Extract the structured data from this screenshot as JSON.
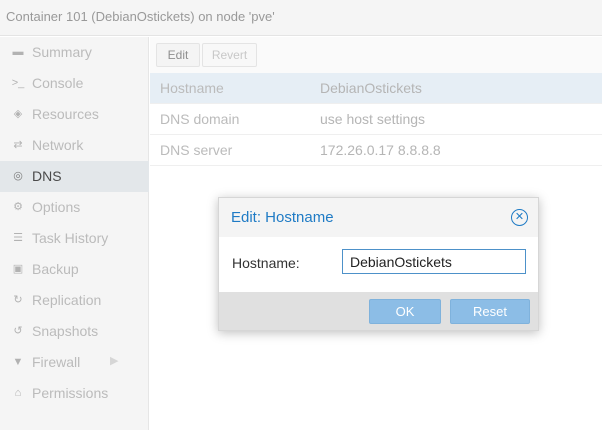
{
  "header": {
    "title": "Container 101 (DebianOstickets) on node 'pve'"
  },
  "sidebar": {
    "items": [
      {
        "label": "Summary",
        "icon": "document-icon",
        "glyph": "▬"
      },
      {
        "label": "Console",
        "icon": "terminal-icon",
        "glyph": ">_"
      },
      {
        "label": "Resources",
        "icon": "cube-icon",
        "glyph": "◈"
      },
      {
        "label": "Network",
        "icon": "exchange-icon",
        "glyph": "⇄"
      },
      {
        "label": "DNS",
        "icon": "globe-icon",
        "glyph": "◎"
      },
      {
        "label": "Options",
        "icon": "gear-icon",
        "glyph": "⚙"
      },
      {
        "label": "Task History",
        "icon": "list-icon",
        "glyph": "☰"
      },
      {
        "label": "Backup",
        "icon": "floppy-icon",
        "glyph": "▣"
      },
      {
        "label": "Replication",
        "icon": "retweet-icon",
        "glyph": "↻"
      },
      {
        "label": "Snapshots",
        "icon": "history-icon",
        "glyph": "↺"
      },
      {
        "label": "Firewall",
        "icon": "shield-icon",
        "glyph": "▼"
      },
      {
        "label": "Permissions",
        "icon": "unlock-icon",
        "glyph": "⌂"
      }
    ],
    "active": "DNS",
    "firewall_arrow": "▶"
  },
  "toolbar": {
    "edit_label": "Edit",
    "revert_label": "Revert"
  },
  "grid": {
    "rows": [
      {
        "key": "Hostname",
        "value": "DebianOstickets"
      },
      {
        "key": "DNS domain",
        "value": "use host settings"
      },
      {
        "key": "DNS server",
        "value": "172.26.0.17 8.8.8.8"
      }
    ],
    "selected_row": 0
  },
  "dialog": {
    "title": "Edit: Hostname",
    "close_glyph": "✕",
    "field_label": "Hostname:",
    "field_value": "DebianOstickets",
    "ok_label": "OK",
    "reset_label": "Reset"
  },
  "colors": {
    "accent": "#1f7bc5",
    "button_disabled": "#8cbde6",
    "selected_row": "#e6eef5"
  }
}
